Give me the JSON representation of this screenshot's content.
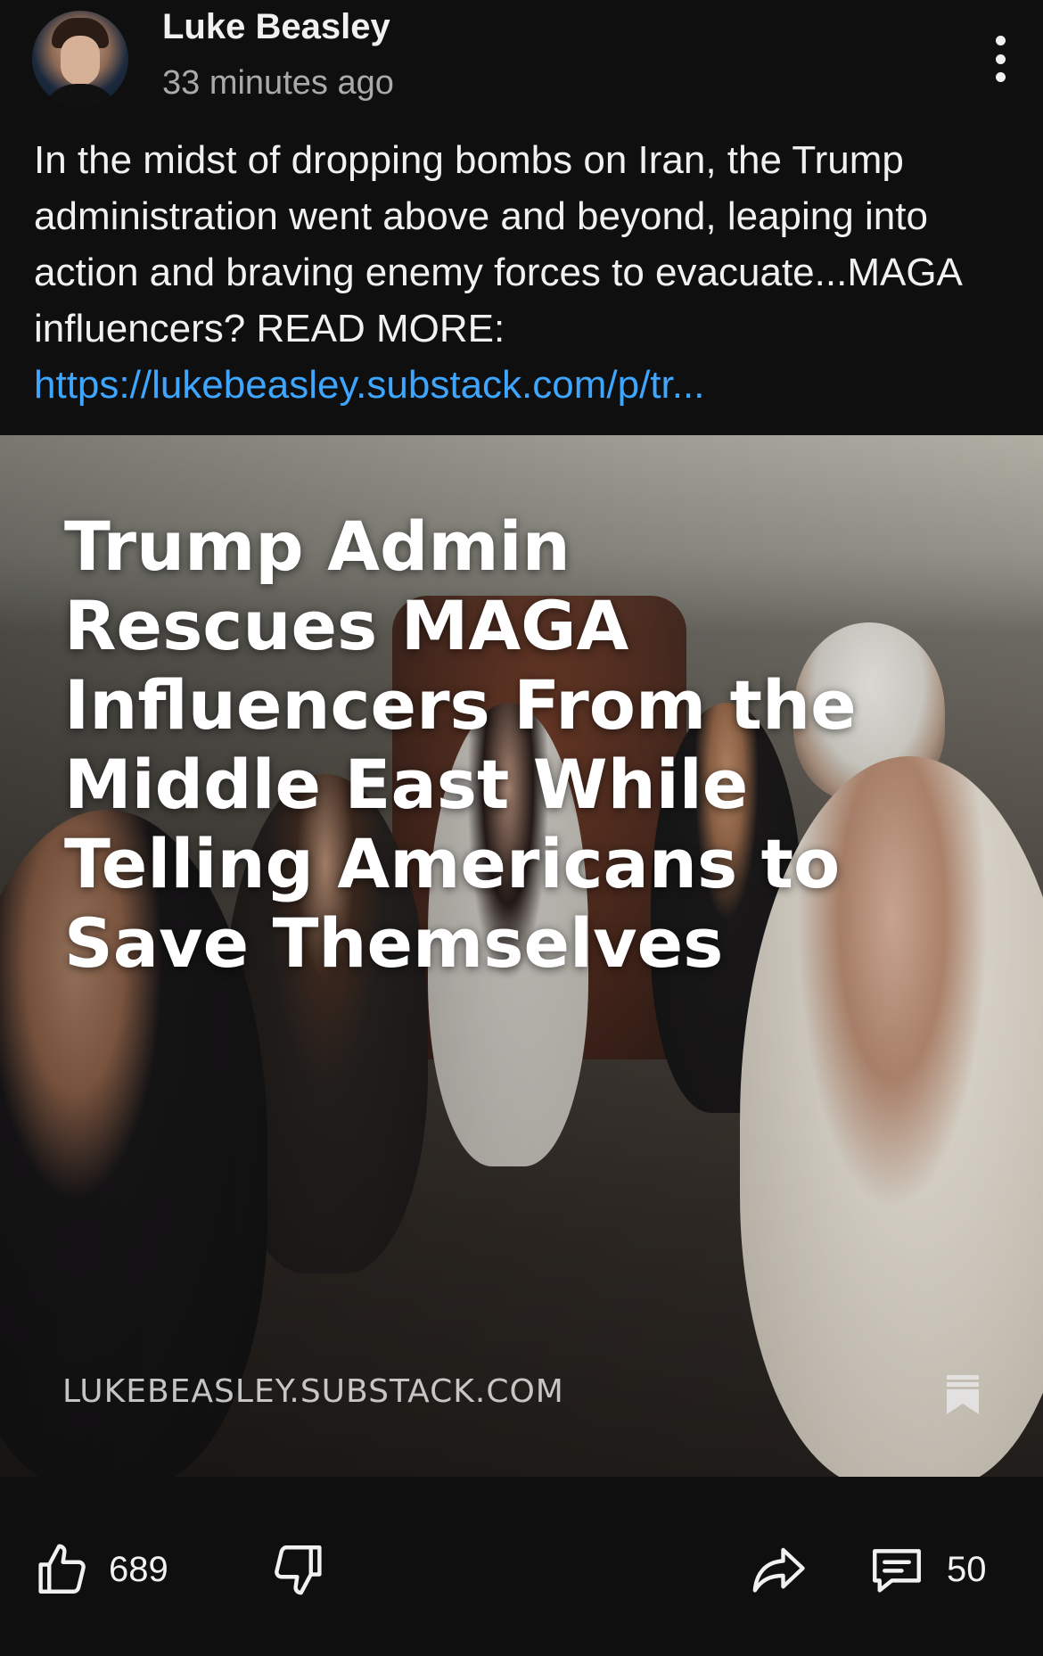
{
  "post": {
    "author": "Luke Beasley",
    "timestamp": "33 minutes ago",
    "text": "In the midst of dropping bombs on Iran, the Trump administration went above and beyond, leaping into action and braving enemy forces to evacuate...MAGA influencers? READ MORE:",
    "link": "https://lukebeasley.substack.com/p/tr..."
  },
  "thumbnail": {
    "headline": "Trump Admin Rescues MAGA Influencers From the Middle East While Telling Americans to Save Themselves",
    "source": "LUKEBEASLEY.SUBSTACK.COM"
  },
  "actions": {
    "likes": "689",
    "comments": "50"
  },
  "icons": {
    "menu": "more-vertical-icon",
    "like": "thumbs-up-icon",
    "dislike": "thumbs-down-icon",
    "share": "share-arrow-icon",
    "comment": "comment-icon",
    "bookmark": "bookmark-icon"
  },
  "colors": {
    "background": "#0f0f0f",
    "text": "#f1f1f1",
    "secondary_text": "#aaaaaa",
    "link": "#3ea6ff"
  }
}
